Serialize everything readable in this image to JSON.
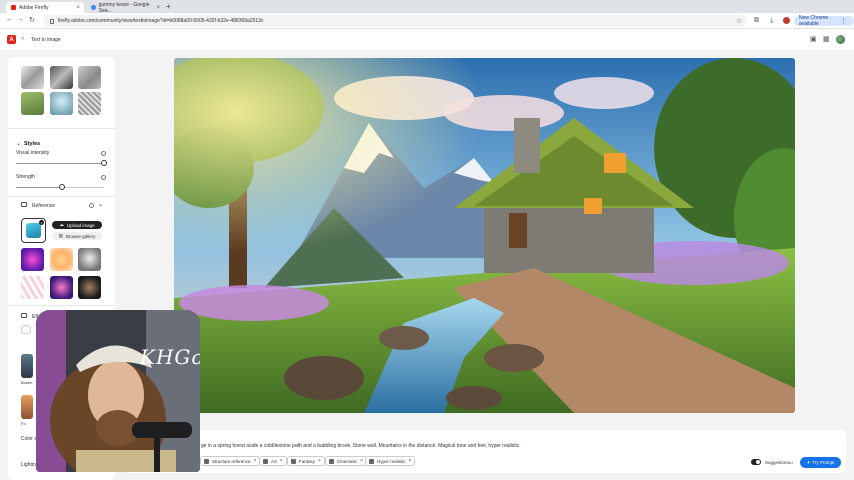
{
  "browser": {
    "tabs": [
      {
        "title": "Adobe Firefly",
        "active": true,
        "favicon_color": "#e1251b"
      },
      {
        "title": "gummy bears - Google Sea...",
        "active": false,
        "favicon_color": "#4285f4"
      }
    ],
    "url": "firefly.adobe.com/community/view/texttoimage?id=b0088a00-5005-432f-b32e-488369a2513c",
    "chrome_badge": "New Chrome available"
  },
  "app": {
    "logo_letter": "A",
    "breadcrumb": "Text to image"
  },
  "panel": {
    "styles_title": "Styles",
    "visual_intensity_label": "Visual intensity",
    "visual_intensity_value": 1.0,
    "strength_label": "Strength",
    "strength_value": 0.5,
    "reference_label": "Reference",
    "upload_image_label": "Upload image",
    "browse_gallery_label": "Browse gallery",
    "effects_label": "Eff",
    "cut_labels": [
      "Bokeh",
      "Fo"
    ],
    "color_label": "Color a",
    "lighting_label": "Lighting"
  },
  "prompt": {
    "text": "ge in a spring forest aside a cobblestone path and a babbling brook. Stone wall. Mountains in the distance. Magical tone and feel, hyper realistic.",
    "chips": [
      "Structure reference",
      "Art",
      "Fantasy",
      "Cinematic",
      "Hyper realistic"
    ],
    "suggestions_label": "Suggestions",
    "suggestions_on": true,
    "try_prompt_label": "Try Prompt"
  },
  "webcam": {
    "overlay_text": "KHGo"
  },
  "colors": {
    "accent": "#1473e6",
    "adobe_red": "#e1251b"
  }
}
